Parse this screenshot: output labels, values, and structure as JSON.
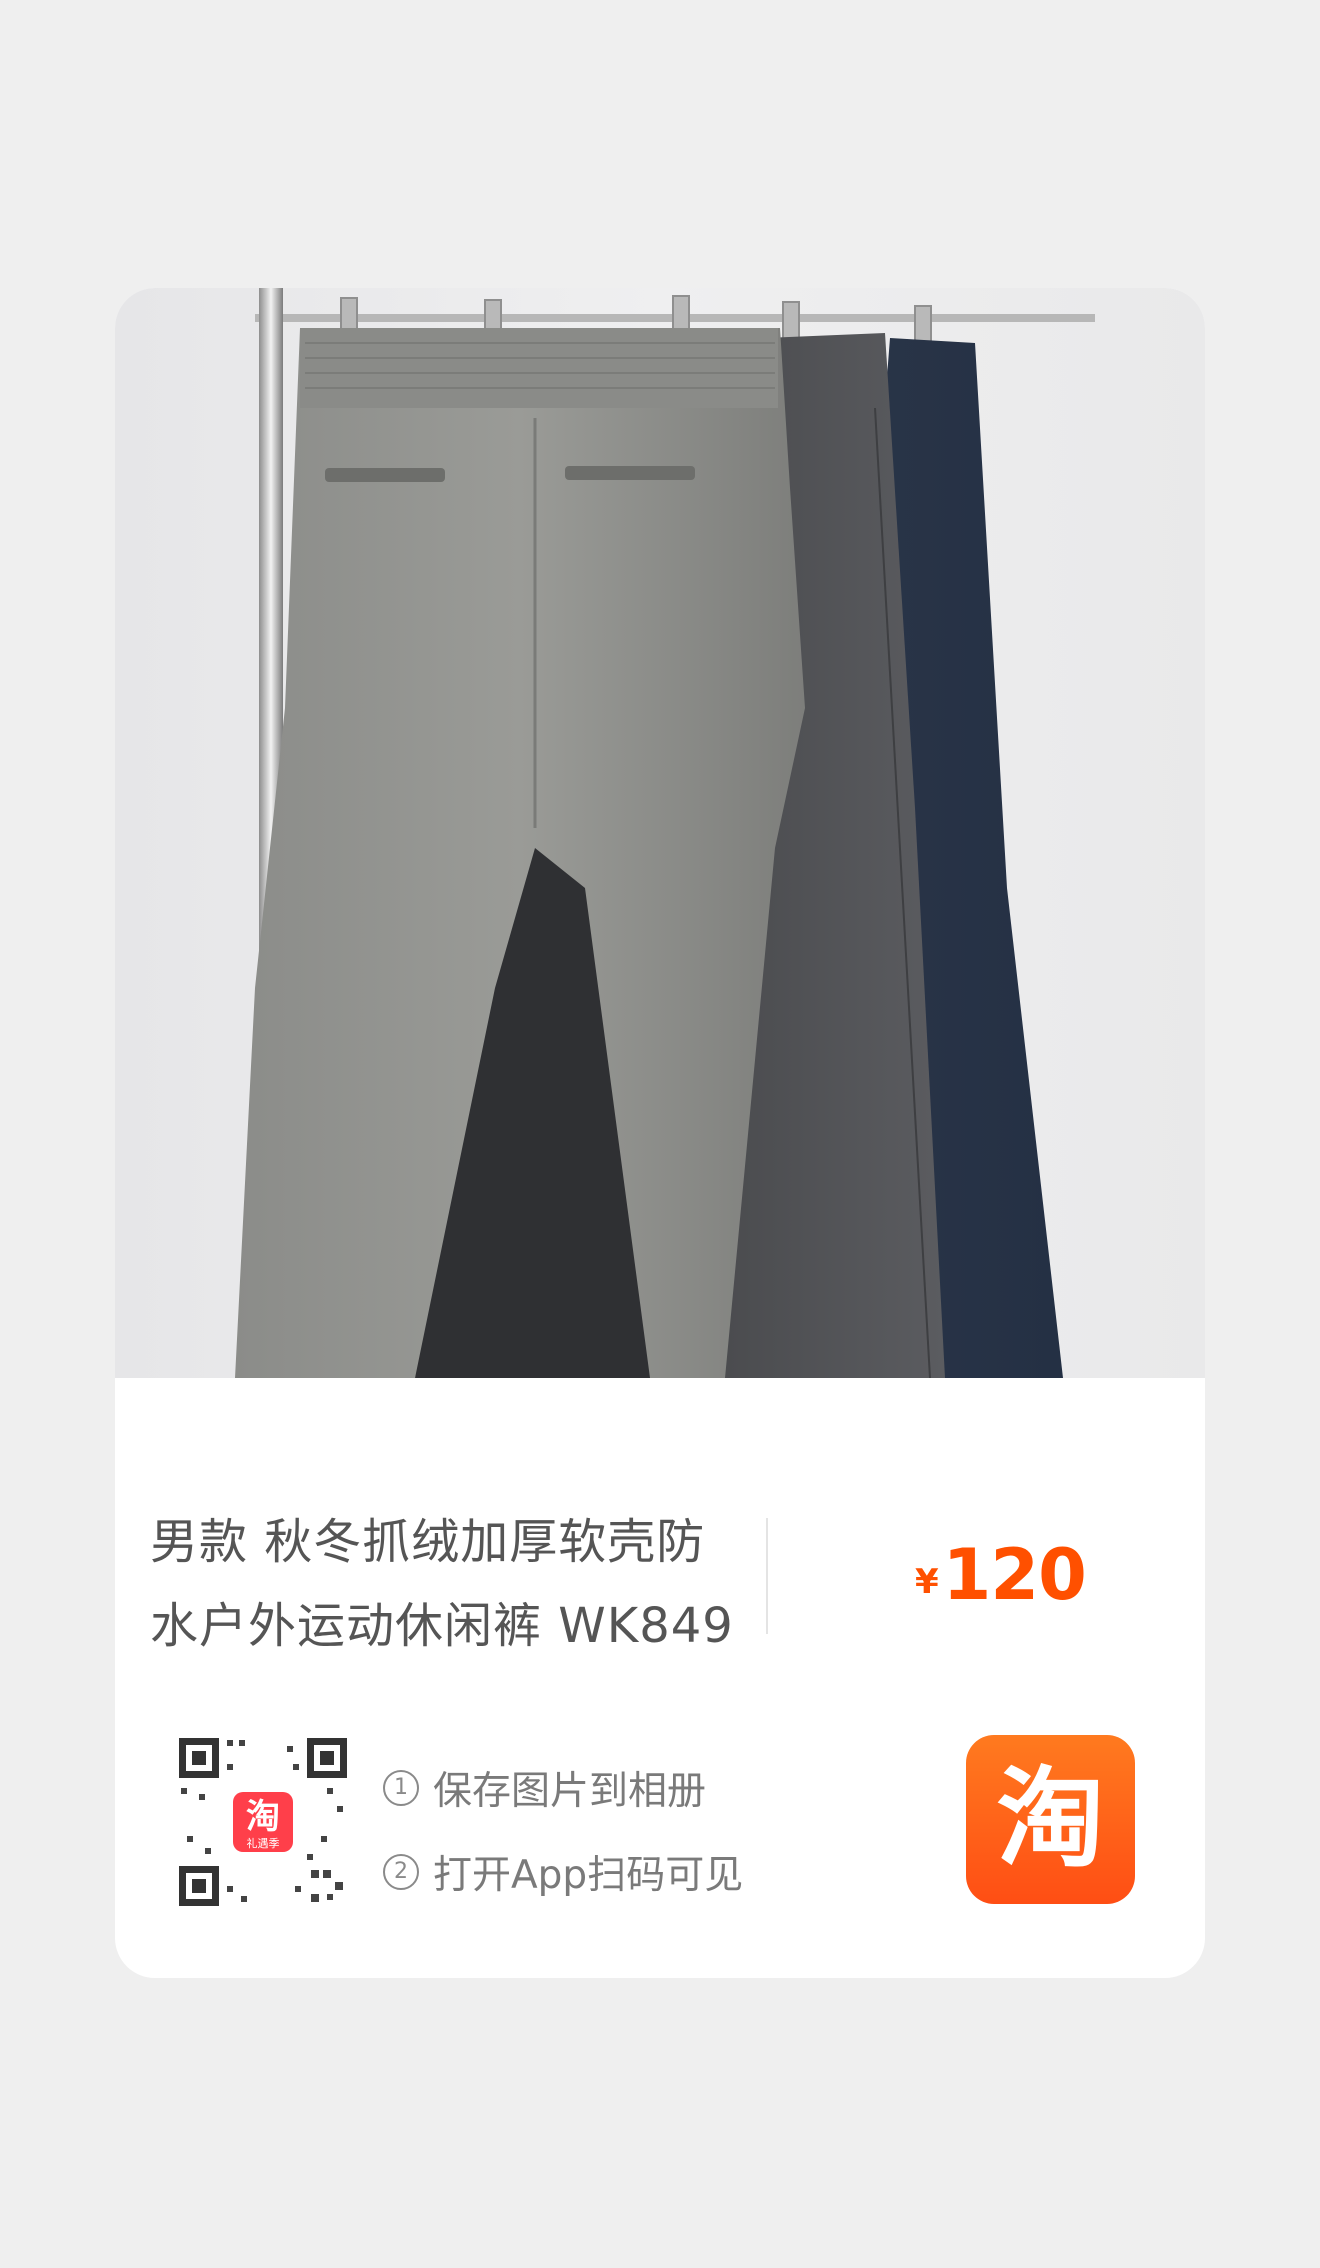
{
  "product": {
    "title_line1": "男款 秋冬抓绒加厚软壳防",
    "title_line2": "水户外运动休闲裤 WK849",
    "currency": "¥",
    "price": "120"
  },
  "share": {
    "step1_num": "1",
    "step1": "保存图片到相册",
    "step2_num": "2",
    "step2": "打开App扫码可见",
    "qr_badge_text": "礼遇季"
  },
  "brand": {
    "logo_text": "淘",
    "accent_color": "#ff5000"
  },
  "colors": {
    "page_bg": "#efefef",
    "card_bg": "#ffffff",
    "title_text": "#555555",
    "secondary_text": "#7a7a7a"
  }
}
